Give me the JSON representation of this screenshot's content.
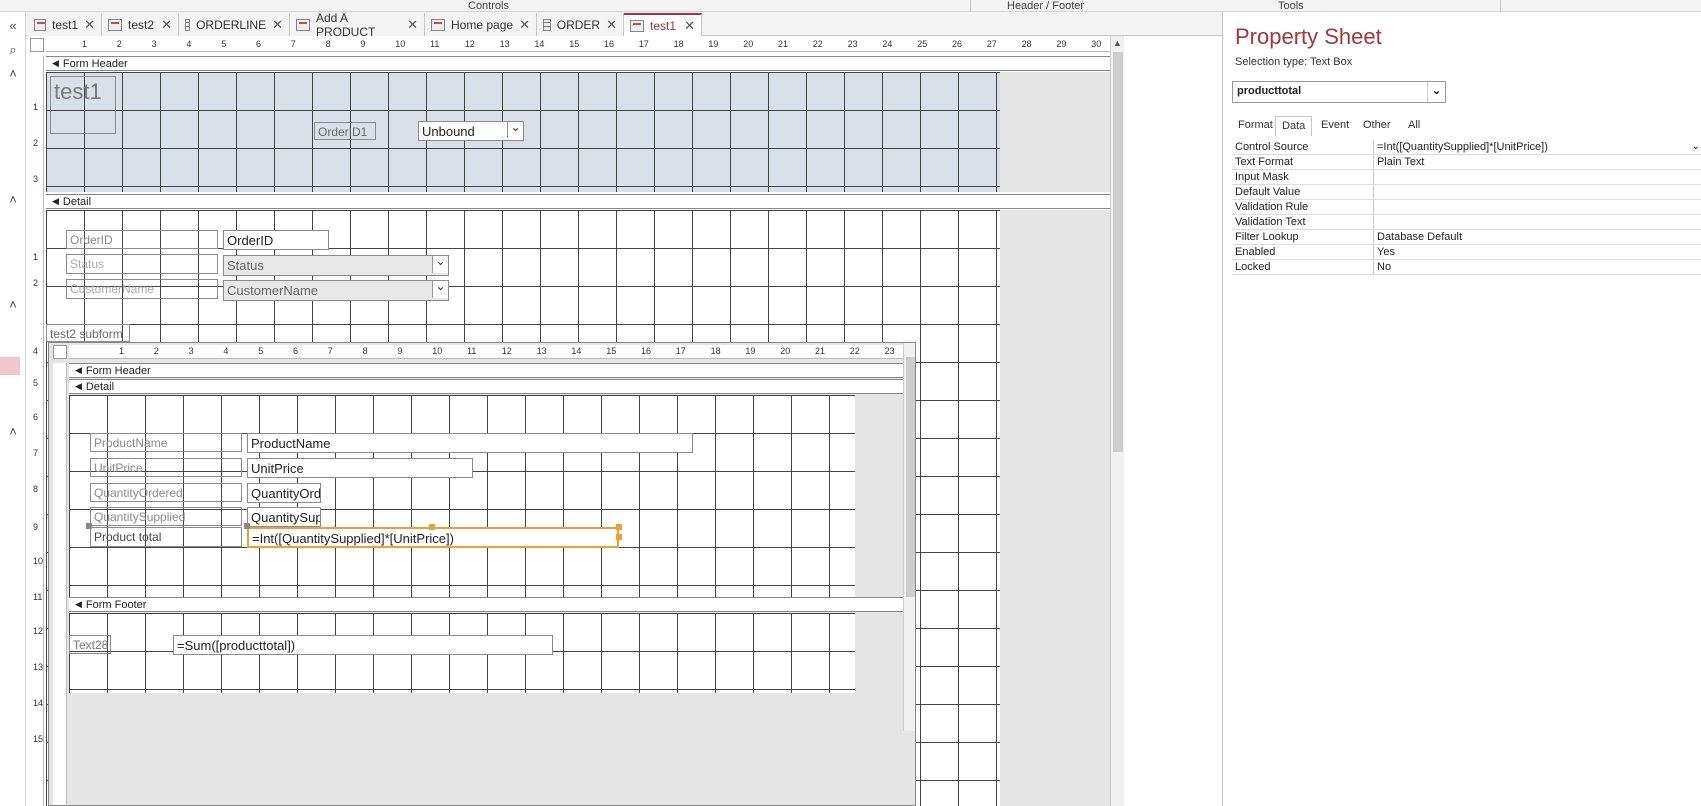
{
  "ribbon": {
    "controls": "Controls",
    "header_footer": "Header / Footer",
    "tools": "Tools"
  },
  "tabs": [
    {
      "label": "test1",
      "icon": "form-icon"
    },
    {
      "label": "test2",
      "icon": "form-icon"
    },
    {
      "label": "ORDERLINE",
      "icon": "table-icon"
    },
    {
      "label": "Add A PRODUCT",
      "icon": "form-icon"
    },
    {
      "label": "Home page",
      "icon": "form-icon"
    },
    {
      "label": "ORDER",
      "icon": "table-icon"
    },
    {
      "label": "test1",
      "icon": "form-icon",
      "active": true
    }
  ],
  "main_form": {
    "form_header_label": "Form Header",
    "detail_label": "Detail",
    "title_label": "test1",
    "orderid1_label": "OrderID1",
    "unbound_value": "Unbound",
    "fields": [
      {
        "label": "OrderID",
        "value": "OrderID"
      },
      {
        "label": "Status",
        "value": "Status"
      },
      {
        "label": "CustomerName",
        "value": "CustomerName"
      }
    ],
    "subform_label": "test2 subform"
  },
  "subform": {
    "form_header_label": "Form Header",
    "detail_label": "Detail",
    "form_footer_label": "Form Footer",
    "fields": [
      {
        "label": "ProductName",
        "value": "ProductName"
      },
      {
        "label": "UnitPrice",
        "value": "UnitPrice"
      },
      {
        "label": "QuantityOrdered",
        "value": "QuantityOrd"
      },
      {
        "label": "QuantitySupplied",
        "value": "QuantitySup"
      },
      {
        "label": "Product total",
        "value": "=Int([QuantitySupplied]*[UnitPrice])"
      }
    ],
    "footer_label": "Text28",
    "footer_value": "=Sum([producttotal])"
  },
  "ruler_main": [
    "1",
    "2",
    "3",
    "4",
    "5",
    "6",
    "7",
    "8",
    "9",
    "10",
    "11",
    "12",
    "13",
    "14",
    "15",
    "16",
    "17",
    "18",
    "19",
    "20",
    "21",
    "22",
    "23",
    "24",
    "25",
    "26",
    "27",
    "28",
    "29",
    "30"
  ],
  "ruler_sub": [
    "1",
    "2",
    "3",
    "4",
    "5",
    "6",
    "7",
    "8",
    "9",
    "10",
    "11",
    "12",
    "13",
    "14",
    "15",
    "16",
    "17",
    "18",
    "19",
    "20",
    "21",
    "22",
    "23",
    "24"
  ],
  "property_sheet": {
    "title": "Property Sheet",
    "selection_type": "Selection type:  Text Box",
    "selected_control": "producttotal",
    "tabs": [
      "Format",
      "Data",
      "Event",
      "Other",
      "All"
    ],
    "active_tab": "Data",
    "rows": [
      {
        "key": "Control Source",
        "value": "=Int([QuantitySupplied]*[UnitPrice])"
      },
      {
        "key": "Text Format",
        "value": "Plain Text"
      },
      {
        "key": "Input Mask",
        "value": ""
      },
      {
        "key": "Default Value",
        "value": ""
      },
      {
        "key": "Validation Rule",
        "value": ""
      },
      {
        "key": "Validation Text",
        "value": ""
      },
      {
        "key": "Filter Lookup",
        "value": "Database Default"
      },
      {
        "key": "Enabled",
        "value": "Yes"
      },
      {
        "key": "Locked",
        "value": "No"
      }
    ]
  },
  "colors": {
    "accent": "#a4373a",
    "selection": "#f0a030",
    "header_band": "#d8dfe9"
  }
}
